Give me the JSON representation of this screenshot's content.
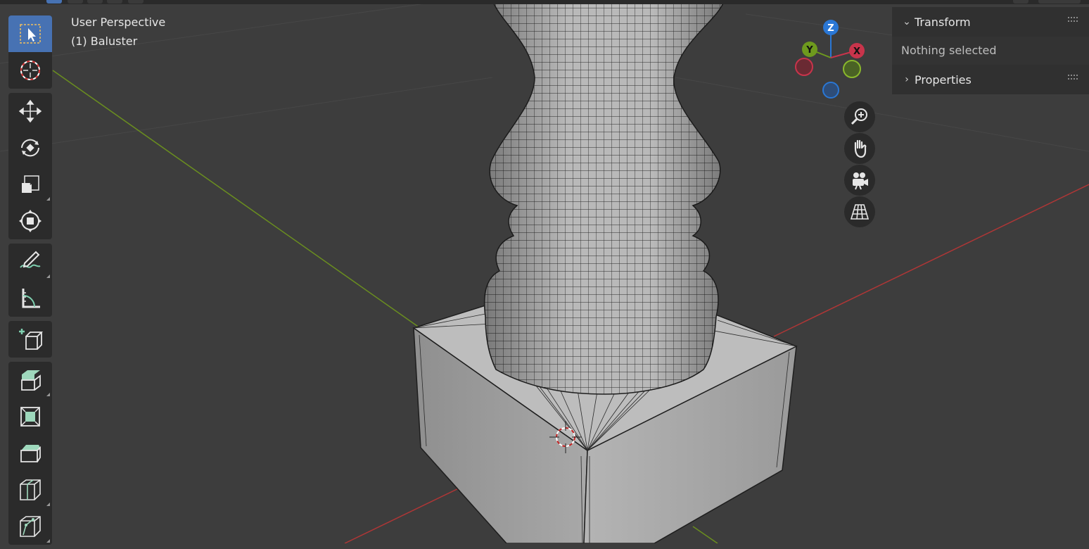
{
  "viewport": {
    "view_name": "User Perspective",
    "object_label": "(1) Baluster"
  },
  "toolbar": {
    "groups": [
      [
        "select-box-tool",
        "cursor-tool"
      ],
      [
        "move-tool",
        "rotate-tool",
        "scale-tool",
        "transform-tool"
      ],
      [
        "annotate-tool",
        "measure-tool"
      ],
      [
        "add-cube-tool"
      ],
      [
        "extrude-region-tool",
        "inset-faces-tool",
        "bevel-tool",
        "loop-cut-tool",
        "knife-tool"
      ]
    ],
    "active": "select-box-tool"
  },
  "gizmo": {
    "z_label": "Z",
    "y_label": "Y",
    "x_label": "X",
    "colors": {
      "x": "#c8344b",
      "y": "#6e9a1e",
      "z": "#2a77d5"
    }
  },
  "nav_buttons": [
    "zoom-icon",
    "pan-hand-icon",
    "camera-icon",
    "grid-perspective-icon"
  ],
  "side_panel": {
    "transform_title": "Transform",
    "transform_body": "Nothing selected",
    "properties_title": "Properties"
  },
  "colors": {
    "background": "#3d3d3d",
    "active_tool": "#4772b3",
    "axis_x": "#b03636",
    "axis_y": "#6a8e1f"
  }
}
